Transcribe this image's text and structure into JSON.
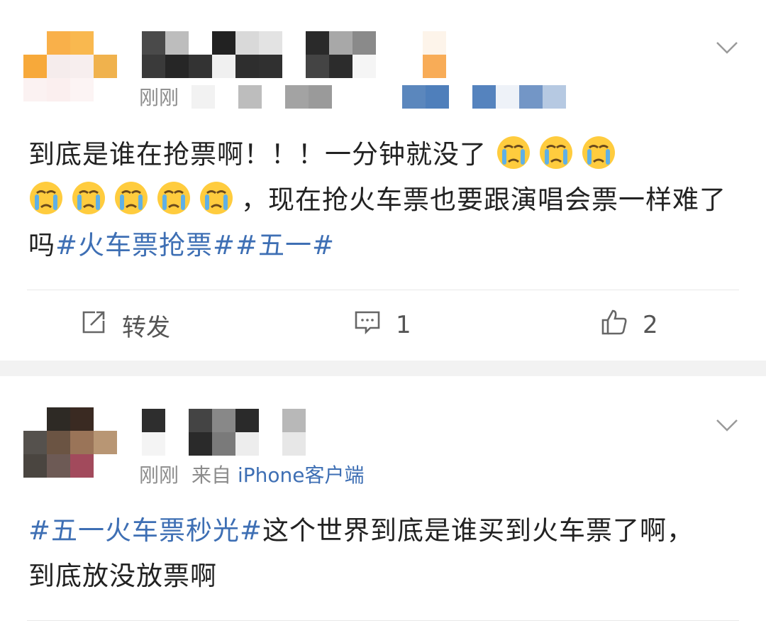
{
  "posts": [
    {
      "time": "刚刚",
      "content_text": "到底是谁在抢票啊！！！一分钟就没了",
      "content_text2": "，现在抢火车票也要跟演唱会票一样难了吗",
      "hashtags": [
        "#火车票抢票#",
        "#五一#"
      ],
      "emoji_name": "crying-face",
      "actions": {
        "repost_label": "转发",
        "comment_count": "1",
        "like_count": "2"
      }
    },
    {
      "time": "刚刚",
      "source_prefix": "来自",
      "source_name": "iPhone客户端",
      "hashtag": "#五一火车票秒光#",
      "content_text": "这个世界到底是谁买到火车票了啊，到底放没放票啊"
    }
  ],
  "colors": {
    "link": "#3e6fb4",
    "text": "#222222",
    "meta": "#8c8c8c",
    "separator": "#f2f2f2"
  },
  "icons": [
    "chevron-down-icon",
    "repost-icon",
    "comment-icon",
    "like-icon",
    "crying-face-emoji"
  ]
}
